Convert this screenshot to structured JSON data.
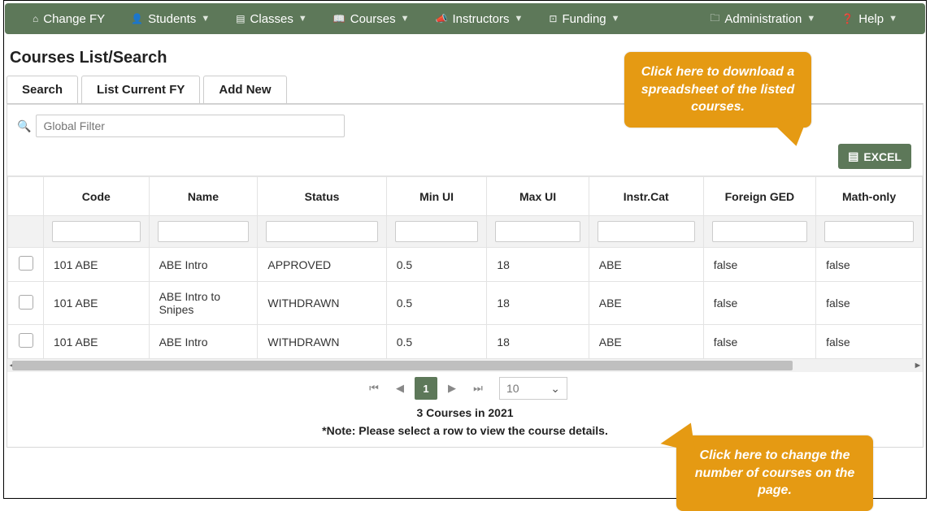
{
  "nav": {
    "items": [
      {
        "label": "Change FY",
        "icon": "⌂",
        "dropdown": false
      },
      {
        "label": "Students",
        "icon": "👤",
        "dropdown": true
      },
      {
        "label": "Classes",
        "icon": "▤",
        "dropdown": true
      },
      {
        "label": "Courses",
        "icon": "📖",
        "dropdown": true
      },
      {
        "label": "Instructors",
        "icon": "📣",
        "dropdown": true
      },
      {
        "label": "Funding",
        "icon": "⊡",
        "dropdown": true
      },
      {
        "label": "Administration",
        "icon": "🗀",
        "dropdown": true
      },
      {
        "label": "Help",
        "icon": "❓",
        "dropdown": true
      }
    ]
  },
  "page_title": "Courses List/Search",
  "tabs": [
    {
      "label": "Search"
    },
    {
      "label": "List Current FY"
    },
    {
      "label": "Add New"
    }
  ],
  "global_filter_placeholder": "Global Filter",
  "excel_button": "EXCEL",
  "columns": [
    "Code",
    "Name",
    "Status",
    "Min UI",
    "Max UI",
    "Instr.Cat",
    "Foreign GED",
    "Math-only"
  ],
  "rows": [
    {
      "code": "101 ABE",
      "name": "ABE Intro",
      "status": "APPROVED",
      "min": "0.5",
      "max": "18",
      "cat": "ABE",
      "fged": "false",
      "math": "false"
    },
    {
      "code": "101 ABE",
      "name": "ABE Intro to Snipes",
      "status": "WITHDRAWN",
      "min": "0.5",
      "max": "18",
      "cat": "ABE",
      "fged": "false",
      "math": "false"
    },
    {
      "code": "101 ABE",
      "name": "ABE Intro",
      "status": "WITHDRAWN",
      "min": "0.5",
      "max": "18",
      "cat": "ABE",
      "fged": "false",
      "math": "false"
    }
  ],
  "pager": {
    "current": "1",
    "page_size": "10"
  },
  "summary": "3 Courses in 2021",
  "note": "*Note: Please select a row to view the course details.",
  "callouts": {
    "excel": "Click here to download a spreadsheet of the listed courses.",
    "pagesize": "Click here to change the number of courses on the page."
  }
}
